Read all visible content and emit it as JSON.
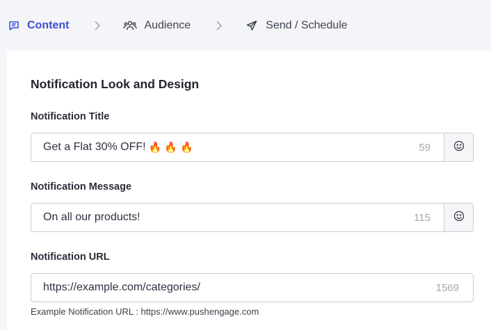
{
  "stepper": {
    "steps": [
      {
        "label": "Content",
        "icon": "message-square-icon",
        "state": "active"
      },
      {
        "label": "Audience",
        "icon": "users-icon",
        "state": "inactive"
      },
      {
        "label": "Send / Schedule",
        "icon": "send-icon",
        "state": "inactive"
      }
    ]
  },
  "form": {
    "section_title": "Notification Look and Design",
    "title": {
      "label": "Notification Title",
      "value": "Get a Flat 30% OFF!",
      "emoji": [
        "🔥",
        "🔥",
        "🔥"
      ],
      "remaining": "59"
    },
    "message": {
      "label": "Notification Message",
      "value": "On all our products!",
      "remaining": "115"
    },
    "url": {
      "label": "Notification URL",
      "value": "https://example.com/categories/",
      "remaining": "1569",
      "helper": "Example Notification URL : https://www.pushengage.com"
    }
  },
  "colors": {
    "accent": "#3a4fd0",
    "border": "#c9ccd4",
    "muted": "#a4a7b1"
  }
}
